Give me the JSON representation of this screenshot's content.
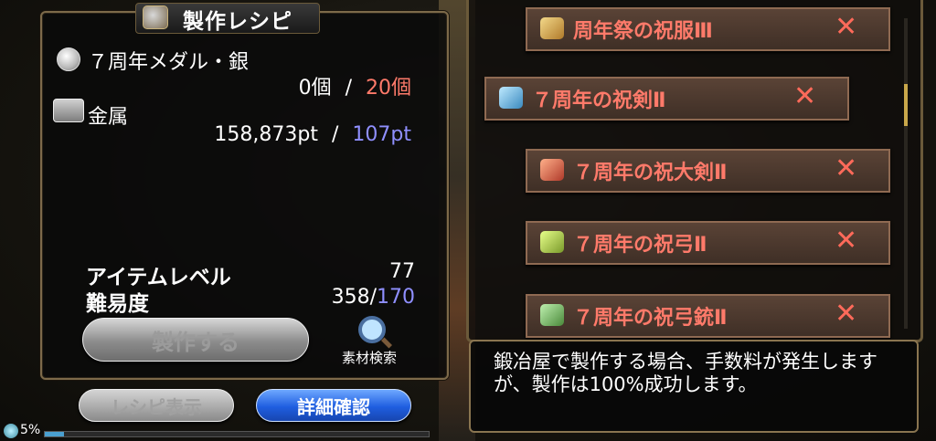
{
  "left_panel": {
    "title": "製作レシピ",
    "materials": [
      {
        "name": "７周年メダル・銀",
        "owned": "0個",
        "separator": "/",
        "required": "20個",
        "icon": "silver-medal-icon"
      },
      {
        "name": "金属",
        "owned": "158,873pt",
        "separator": "/",
        "required": "107pt",
        "icon": "metal-ingot-icon"
      }
    ],
    "stats": {
      "item_level_label": "アイテムレベル",
      "item_level_value": "77",
      "difficulty_label": "難易度",
      "difficulty_current": "358",
      "difficulty_separator": "/",
      "difficulty_required": "170"
    },
    "craft_button": "製作する",
    "material_search_label": "素材検索",
    "recipe_button": "レシピ表示",
    "detail_button": "詳細確認"
  },
  "status": {
    "percent_text": "5%",
    "progress": 0.05
  },
  "recipe_list": [
    {
      "name": "周年祭の祝服Ⅲ",
      "icon": "robe-icon",
      "x": "✕"
    },
    {
      "name": "７周年の祝剣Ⅱ",
      "icon": "sword-icon",
      "x": "✕"
    },
    {
      "name": "７周年の祝大剣Ⅱ",
      "icon": "greatsword-icon",
      "x": "✕"
    },
    {
      "name": "７周年の祝弓Ⅱ",
      "icon": "bow-icon",
      "x": "✕"
    },
    {
      "name": "７周年の祝弓銃Ⅱ",
      "icon": "crossbow-icon",
      "x": "✕"
    }
  ],
  "message": "鍛冶屋で製作する場合、手数料が発生しますが、製作は100%成功します。",
  "colors": {
    "accent_red": "#ff7a6a",
    "accent_blue": "#8f8fff",
    "detail_button": "#1f5ee0"
  }
}
